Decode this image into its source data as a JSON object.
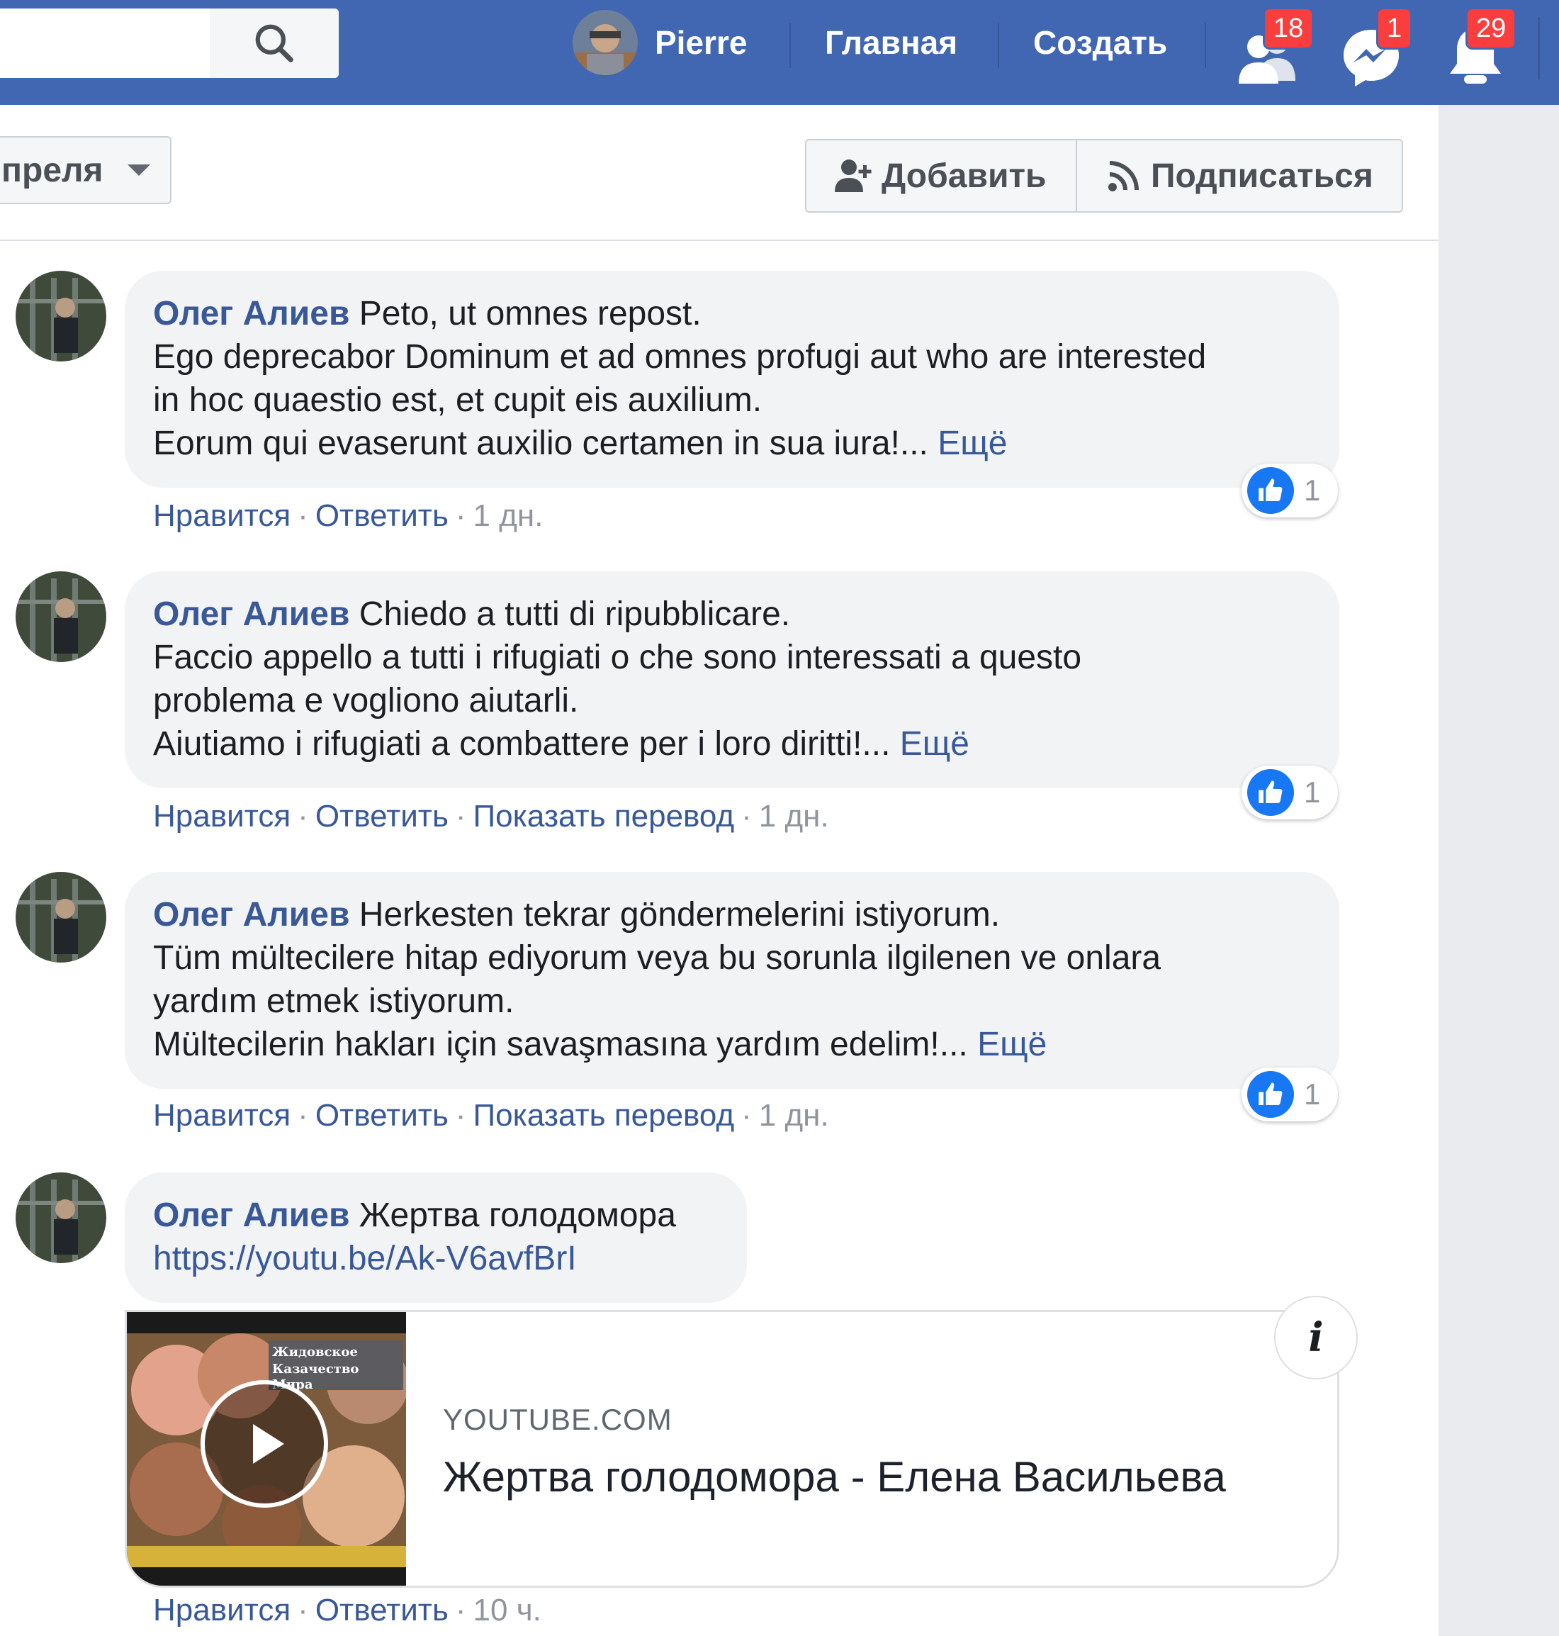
{
  "topbar": {
    "profile_name": "Pierre",
    "home_label": "Главная",
    "create_label": "Создать",
    "friend_requests_count": "18",
    "messages_count": "1",
    "notifications_count": "29",
    "icons": [
      "search-icon",
      "friends-icon",
      "messenger-icon",
      "bell-icon"
    ],
    "brand_color": "#4267b2"
  },
  "header": {
    "date_filter_value": "преля",
    "add_label": "Добавить",
    "subscribe_label": "Подписаться"
  },
  "comments": [
    {
      "author": "Олег Алиев",
      "first_line": " Peto, ut omnes repost.",
      "lines": [
        "Ego deprecabor Dominum et ad omnes profugi aut who are interested",
        "in hoc quaestio est, et cupit eis auxilium.",
        "Eorum qui evaserunt auxilio certamen in sua iura!..."
      ],
      "more_label": "Ещё",
      "like_count": "1",
      "actions": {
        "like": "Нравится",
        "reply": "Ответить",
        "time": "1 дн."
      }
    },
    {
      "author": "Олег Алиев",
      "first_line": " Chiedo a tutti di ripubblicare.",
      "lines": [
        "Faccio appello a tutti i rifugiati o che sono interessati a questo",
        "problema e vogliono aiutarli.",
        "Aiutiamo i rifugiati a combattere per i loro diritti!..."
      ],
      "more_label": "Ещё",
      "like_count": "1",
      "actions": {
        "like": "Нравится",
        "reply": "Ответить",
        "translate": "Показать перевод",
        "time": "1 дн."
      }
    },
    {
      "author": "Олег Алиев",
      "first_line": " Herkesten tekrar göndermelerini istiyorum.",
      "lines": [
        "Tüm mültecilere hitap ediyorum veya bu sorunla ilgilenen ve onlara",
        "yardım etmek istiyorum.",
        "Mültecilerin hakları için savaşmasına yardım edelim!..."
      ],
      "more_label": "Ещё",
      "like_count": "1",
      "actions": {
        "like": "Нравится",
        "reply": "Ответить",
        "translate": "Показать перевод",
        "time": "1 дн."
      }
    },
    {
      "author": "Олег Алиев",
      "first_line": " Жертва голодомора",
      "link": "https://youtu.be/Ak-V6avfBrI",
      "actions": {
        "like": "Нравится",
        "reply": "Ответить",
        "time": "10 ч."
      }
    }
  ],
  "link_card": {
    "domain": "YOUTUBE.COM",
    "title": "Жертва голодомора - Елена Васильева",
    "info_icon": "i",
    "thumb_text_1": "Жидовское",
    "thumb_text_2": "Казачество",
    "thumb_text_3": "Мира"
  }
}
